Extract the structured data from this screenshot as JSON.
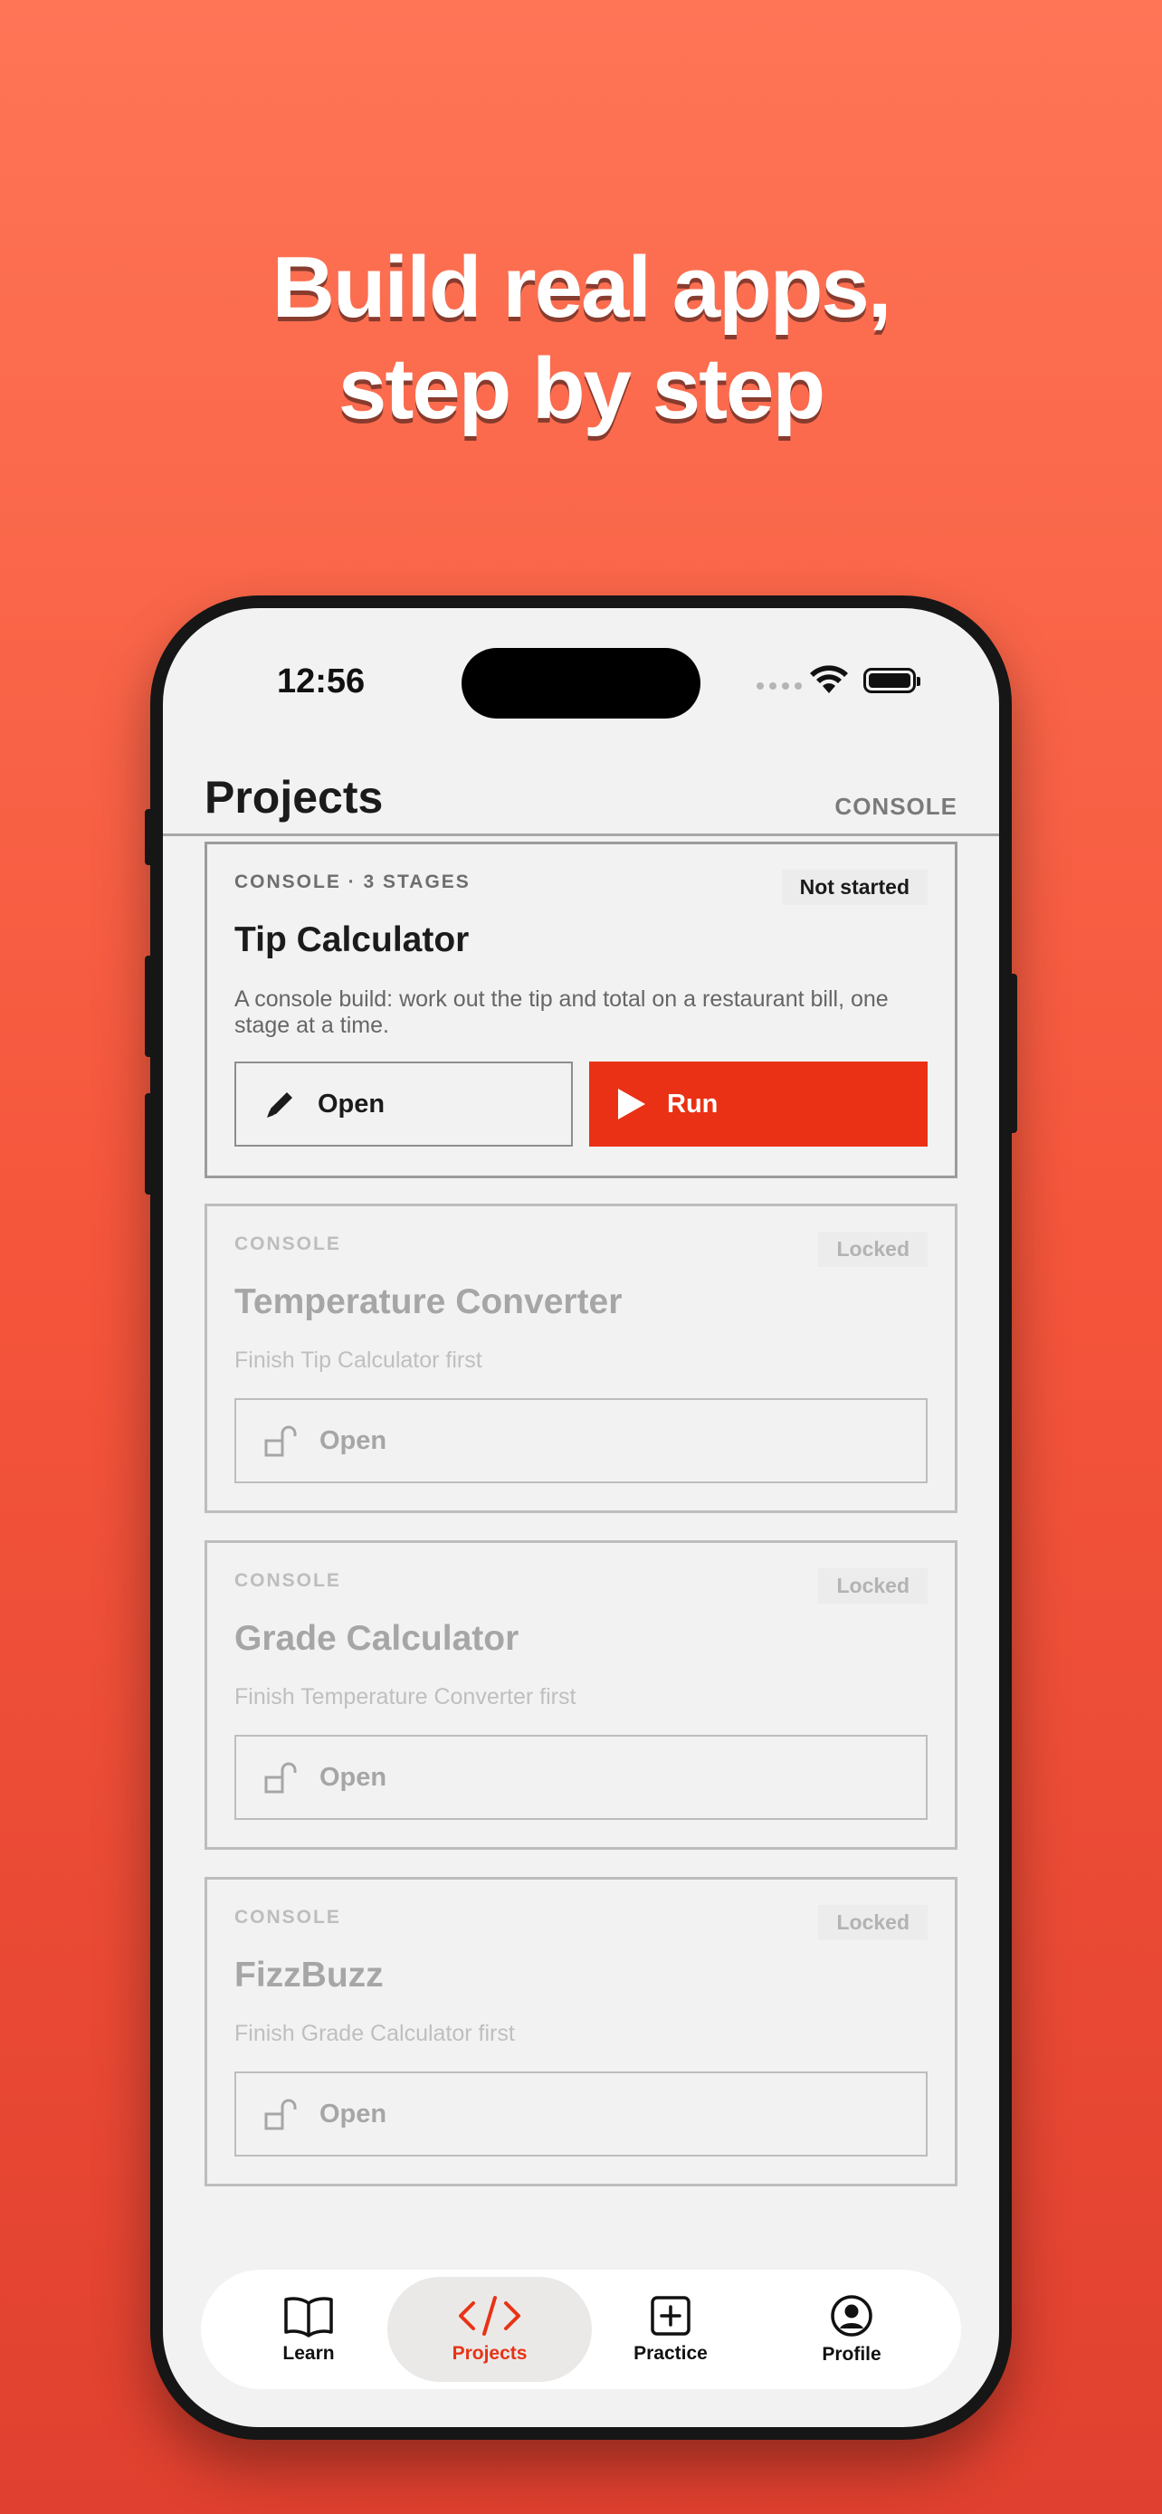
{
  "headline": {
    "line1": "Build real apps,",
    "line2": "step by step"
  },
  "status_bar": {
    "time": "12:56"
  },
  "nav": {
    "title": "Projects",
    "action": "CONSOLE"
  },
  "projects": [
    {
      "tag": "CONSOLE · 3 STAGES",
      "status": "Not started",
      "title": "Tip Calculator",
      "description": "A console build: work out the tip and total on a restaurant bill, one stage at a time.",
      "open_label": "Open",
      "run_label": "Run"
    },
    {
      "tag": "CONSOLE",
      "status": "Locked",
      "title": "Temperature Converter",
      "description": "Finish Tip Calculator first",
      "open_label": "Open"
    },
    {
      "tag": "CONSOLE",
      "status": "Locked",
      "title": "Grade Calculator",
      "description": "Finish Temperature Converter first",
      "open_label": "Open"
    },
    {
      "tag": "CONSOLE",
      "status": "Locked",
      "title": "FizzBuzz",
      "description": "Finish Grade Calculator first",
      "open_label": "Open"
    }
  ],
  "tabs": [
    {
      "label": "Learn",
      "icon": "book-icon"
    },
    {
      "label": "Projects",
      "icon": "code-icon",
      "selected": true
    },
    {
      "label": "Practice",
      "icon": "plus-square-icon"
    },
    {
      "label": "Profile",
      "icon": "person-circle-icon"
    }
  ],
  "colors": {
    "accent": "#ea3115",
    "background_top": "#ff7556",
    "background_bottom": "#e0402f"
  }
}
